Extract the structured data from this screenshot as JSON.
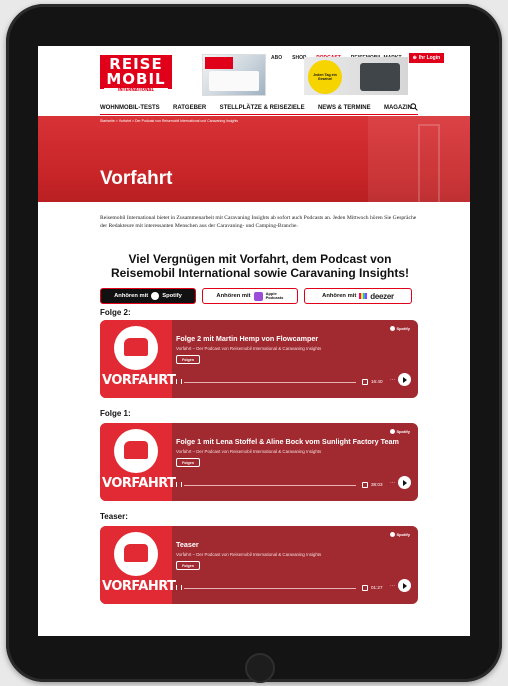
{
  "header": {
    "logo": {
      "line1": "REISE",
      "line2": "MOBIL",
      "line3": "INTERNATIONAL"
    },
    "top_nav": [
      "ABO",
      "SHOP",
      "PODCAST",
      "REISEMOBIL-MARKT"
    ],
    "top_nav_active": "PODCAST",
    "login_label": "Ihr Login",
    "promo_text": "Jeden Tag ein Gewinn!",
    "main_nav": [
      "WOHNMOBIL-TESTS",
      "RATGEBER",
      "STELLPLÄTZE & REISEZIELE",
      "NEWS & TERMINE",
      "MAGAZIN"
    ]
  },
  "hero": {
    "breadcrumb": "Startseite > Vorfahrt > Der Podcast von Reisemobil International und Caravaning Insights",
    "title": "Vorfahrt"
  },
  "intro": "Reisemobil International bietet in Zusammenarbeit mit Caravaning Insights ab sofort auch Podcasts an. Jeden Mittwoch hören Sie Gespräche der Redakteure mit interessanten Menschen aus der Caravaning- und Camping-Branche.",
  "headline": "Viel Vergnügen mit Vorfahrt, dem Podcast von Reisemobil International sowie Caravaning Insights!",
  "platforms": {
    "prefix": "Anhören mit",
    "spotify": "Spotify",
    "apple": "Apple Podcasts",
    "deezer": "deezer"
  },
  "episodes": [
    {
      "section": "Folge 2:",
      "title": "Folge 2 mit Martin Hemp von Flowcamper",
      "show": "Vorfahrt – Der Podcast von Reisemobil International & Caravaning Insights",
      "follow": "Folgen",
      "duration": "16:40"
    },
    {
      "section": "Folge 1:",
      "title": "Folge 1 mit Lena Stoffel & Aline Bock vom Sunlight Factory Team",
      "show": "Vorfahrt – Der Podcast von Reisemobil International & Caravaning Insights",
      "follow": "Folgen",
      "duration": "38:03"
    },
    {
      "section": "Teaser:",
      "title": "Teaser",
      "show": "Vorfahrt – Der Podcast von Reisemobil International & Caravaning Insights",
      "follow": "Folgen",
      "duration": "01:27"
    }
  ],
  "cover_word": "VORFAHRT",
  "spotify_mark": "Spotify",
  "colors": {
    "brand_red": "#e1001a",
    "card_bg": "#a12a31"
  }
}
